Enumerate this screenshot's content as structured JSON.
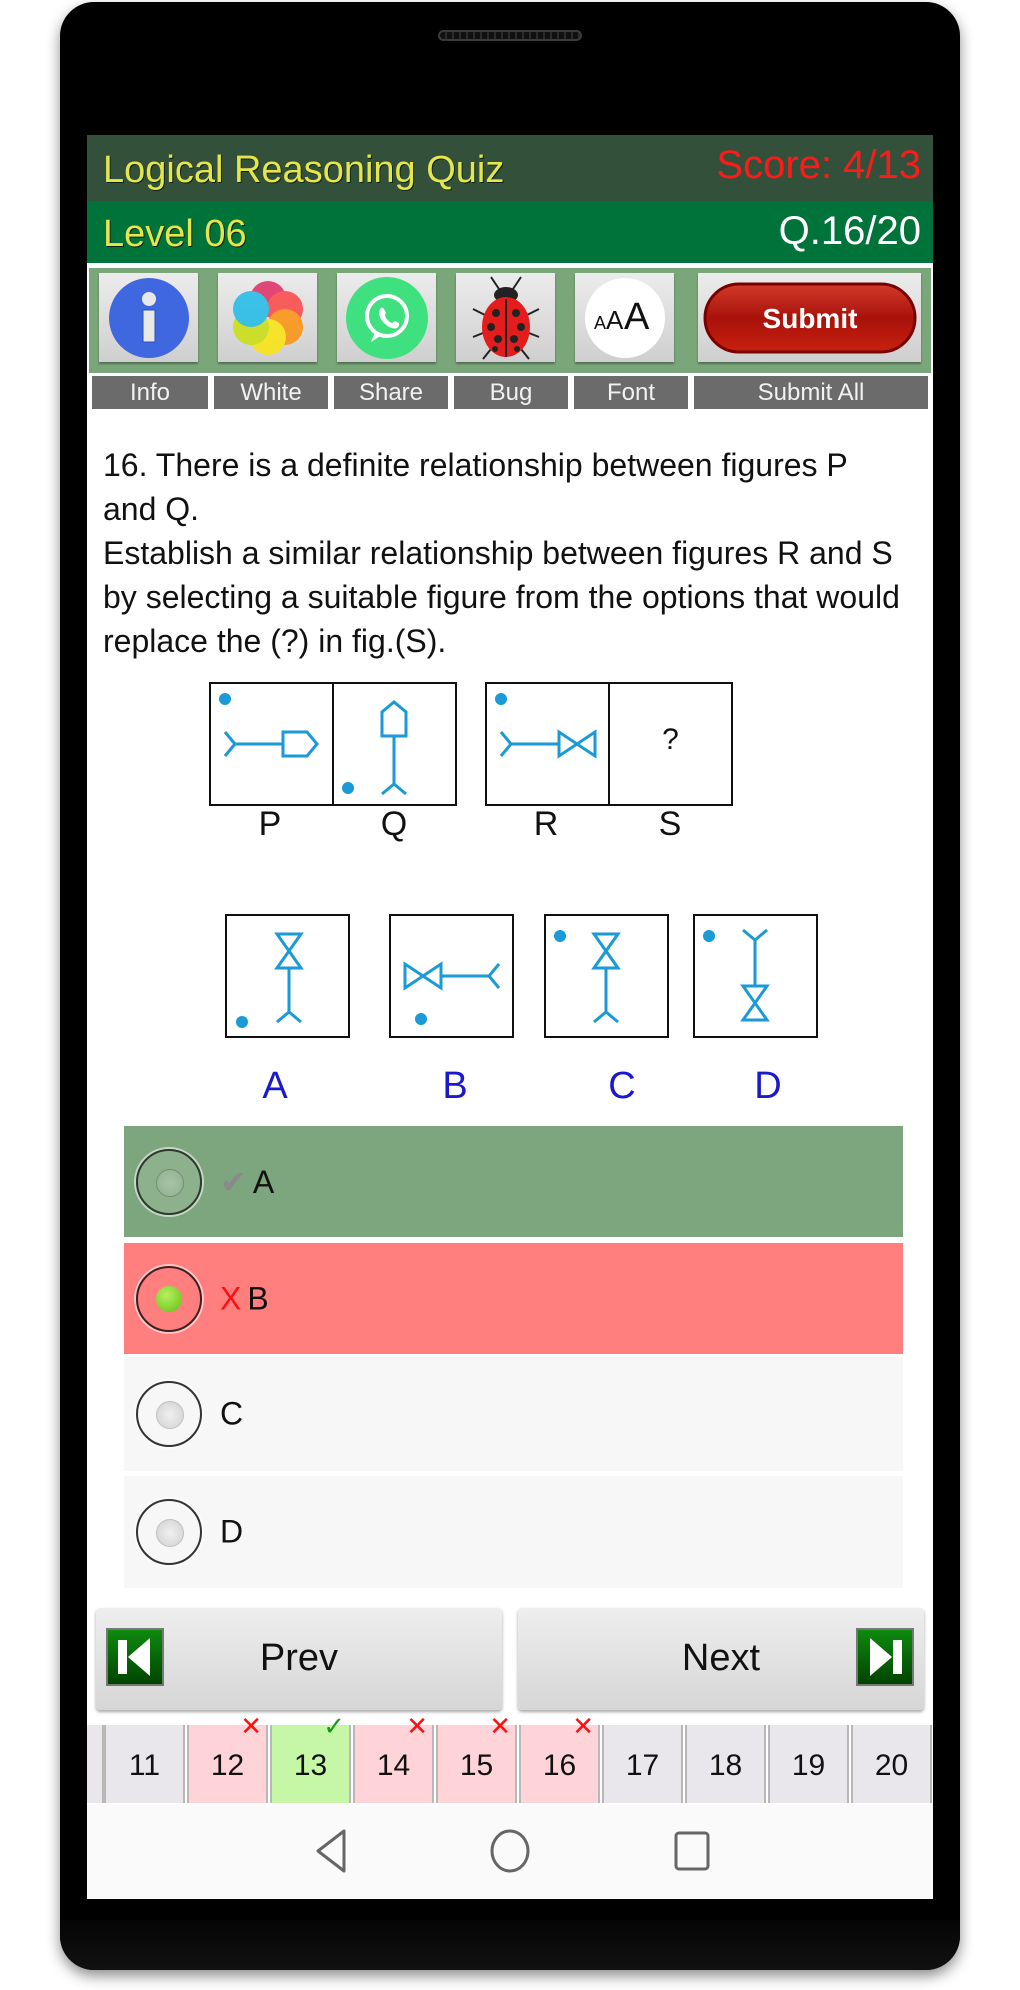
{
  "header": {
    "app_title": "Logical Reasoning Quiz",
    "score": "Score: 4/13",
    "level": "Level 06",
    "question_counter": "Q.16/20"
  },
  "toolbar": {
    "buttons": [
      {
        "label": "Info",
        "icon": "info-icon"
      },
      {
        "label": "White",
        "icon": "color-petals-icon"
      },
      {
        "label": "Share",
        "icon": "whatsapp-icon"
      },
      {
        "label": "Bug",
        "icon": "ladybug-icon"
      },
      {
        "label": "Font",
        "icon": "font-size-icon",
        "icon_text": "AAA"
      },
      {
        "label": "Submit All",
        "button_text": "Submit"
      }
    ]
  },
  "question": {
    "line1": "16. There is a definite relationship between figures P and Q.",
    "line2": "Establish a similar relationship between figures R and S by selecting a suitable figure from the options that would replace the (?) in fig.(S).",
    "figure_labels": [
      "P",
      "Q",
      "R",
      "S"
    ],
    "unknown_mark": "?",
    "option_figure_labels": [
      "A",
      "B",
      "C",
      "D"
    ]
  },
  "options": [
    {
      "letter": "A",
      "mark": "✔",
      "state": "correct",
      "selected": false,
      "bg": "#7ea67e"
    },
    {
      "letter": "B",
      "mark": "X",
      "state": "wrong",
      "selected": true,
      "bg": "#ff7f7f"
    },
    {
      "letter": "C",
      "mark": "",
      "state": "none",
      "selected": false,
      "bg": "#f7f7f7"
    },
    {
      "letter": "D",
      "mark": "",
      "state": "none",
      "selected": false,
      "bg": "#f7f7f7"
    }
  ],
  "navigation": {
    "prev_label": "Prev",
    "next_label": "Next"
  },
  "pages": [
    {
      "num": "11",
      "status": "none"
    },
    {
      "num": "12",
      "status": "wrong",
      "mark": "✕"
    },
    {
      "num": "13",
      "status": "correct",
      "mark": "✓"
    },
    {
      "num": "14",
      "status": "wrong",
      "mark": "✕"
    },
    {
      "num": "15",
      "status": "wrong",
      "mark": "✕"
    },
    {
      "num": "16",
      "status": "wrong",
      "mark": "✕"
    },
    {
      "num": "17",
      "status": "none"
    },
    {
      "num": "18",
      "status": "none"
    },
    {
      "num": "19",
      "status": "none"
    },
    {
      "num": "20",
      "status": "none"
    }
  ],
  "colors": {
    "title_bar": "#33503a",
    "level_bar": "#00733a",
    "title_text": "#e6e64a",
    "score_text": "#ff1a1a",
    "toolbar_bg": "#7aa77a",
    "figure_blue": "#1a9ad6",
    "option_letter_blue": "#1a1acc",
    "page_wrong_bg": "#ffd4d8",
    "page_correct_bg": "#c6f7a6",
    "page_default_bg": "#e9e7ec"
  },
  "system_nav": {
    "back": "back-icon",
    "home": "home-icon",
    "recents": "recents-icon"
  }
}
